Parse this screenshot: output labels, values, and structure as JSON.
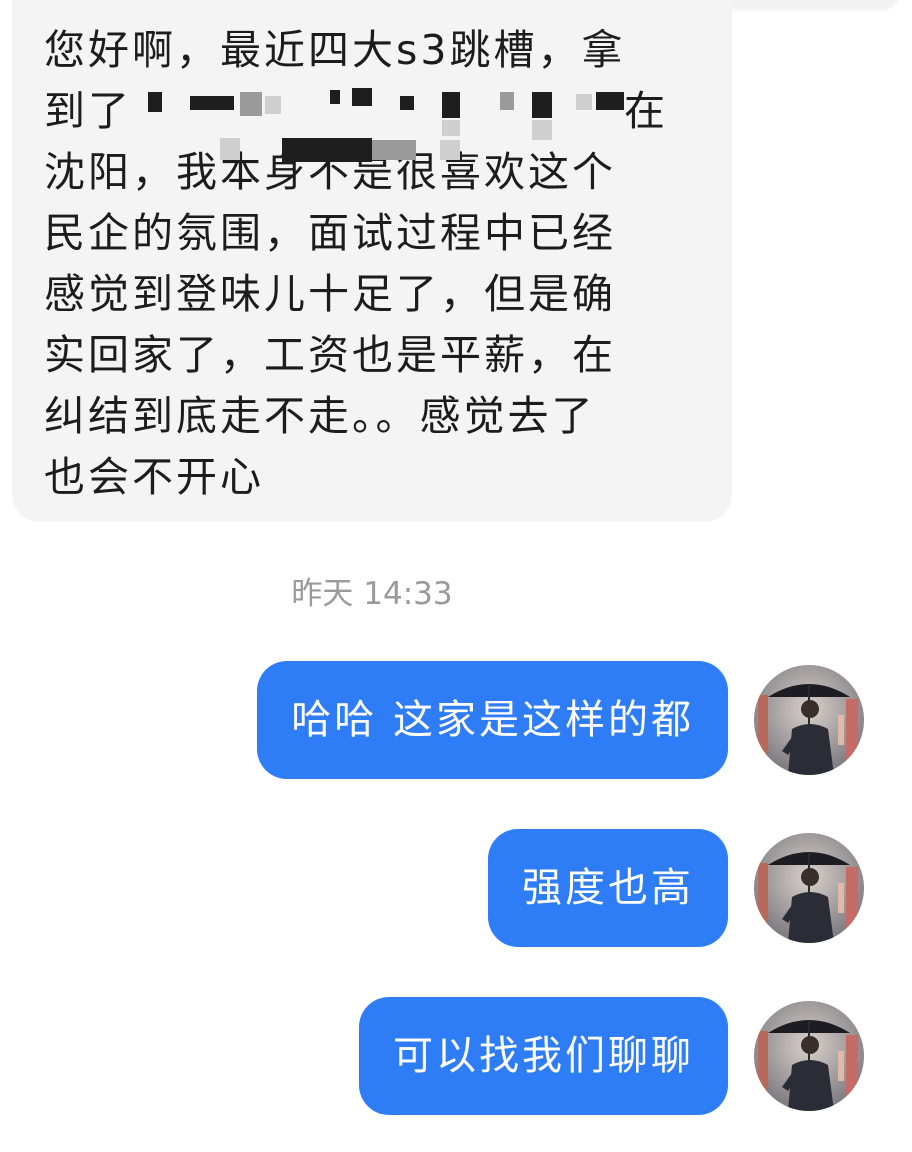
{
  "incoming": {
    "lines": [
      "您好啊，最近四大s3跳槽，拿",
      "到了",
      "沈阳，我本身不是很喜欢这个",
      "民企的氛围，面试过程中已经",
      "感觉到登味儿十足了，但是确",
      "实回家了，工资也是平薪，在",
      "纠结到底走不走。。感觉去了",
      "也会不开心"
    ],
    "line2_tail": "在"
  },
  "timestamp": "昨天 14:33",
  "outgoing": [
    {
      "text": "哈哈 这家是这样的都",
      "avatar": "avatar-umbrella-man"
    },
    {
      "text": "强度也高",
      "avatar": "avatar-umbrella-man"
    },
    {
      "text": "可以找我们聊聊",
      "avatar": "avatar-umbrella-man"
    }
  ],
  "colors": {
    "outgoing_bubble": "#2f7df6",
    "incoming_bubble": "#f4f4f4",
    "timestamp_text": "#9a9a9a"
  }
}
